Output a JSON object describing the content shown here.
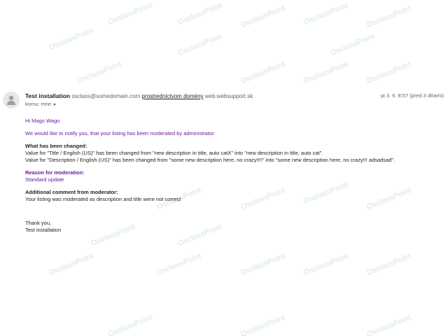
{
  "watermark_text": "OsclassPoint",
  "email": {
    "sender_name": "Test installation",
    "sender_email": "osclass@somedomain.com",
    "via_label": "prostredníctvom domény",
    "via_domain": "web.websupport.sk",
    "date": "pi 3. 6. 8:57 (pred 3 dňami)",
    "recipient": "komu: mne",
    "greeting": "Hi Mago Wago",
    "intro": "We would like to notify you, that your listing has been moderated by administrator.",
    "changes_heading": "What has been changed:",
    "changes": [
      "Value for \"Title / English (US)\" has been changed from \"new description in title, auto catX\" into \"new description in title, auto cat\".",
      "Value for \"Description / English (US)\" has been changed from \"some new description here, no crazy!!!!\" into \"some new description here, no crazy!!! adsadsad\"."
    ],
    "reason_heading": "Reason for moderation:",
    "reason": "Standard update",
    "comment_heading": "Additional comment from moderator:",
    "comment": "Your listing was moderated as description and title were not correct",
    "thanks": "Thank you,",
    "signature": "Test installation"
  },
  "colors": {
    "accent_purple": "#6a1b9a",
    "watermark": "#dfeee6"
  },
  "icons": {
    "avatar": "person-icon",
    "recipient_details": "caret-down-icon"
  }
}
